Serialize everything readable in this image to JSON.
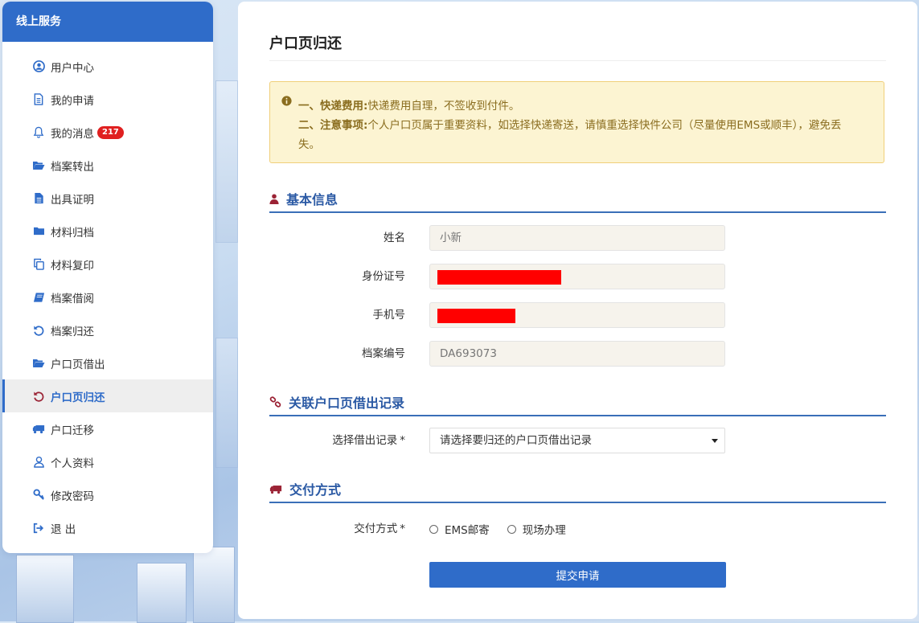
{
  "sidebar": {
    "title": "线上服务",
    "items": [
      {
        "label": "用户中心",
        "icon": "user-circle-icon"
      },
      {
        "label": "我的申请",
        "icon": "document-icon"
      },
      {
        "label": "我的消息",
        "icon": "bell-icon",
        "badge": "217"
      },
      {
        "label": "档案转出",
        "icon": "folder-open-icon"
      },
      {
        "label": "出具证明",
        "icon": "file-icon"
      },
      {
        "label": "材料归档",
        "icon": "folder-icon"
      },
      {
        "label": "材料复印",
        "icon": "copy-icon"
      },
      {
        "label": "档案借阅",
        "icon": "book-icon"
      },
      {
        "label": "档案归还",
        "icon": "undo-icon"
      },
      {
        "label": "户口页借出",
        "icon": "folder-open-icon"
      },
      {
        "label": "户口页归还",
        "icon": "undo-icon",
        "active": true
      },
      {
        "label": "户口迁移",
        "icon": "truck-icon"
      },
      {
        "label": "个人资料",
        "icon": "user-icon"
      },
      {
        "label": "修改密码",
        "icon": "key-icon"
      },
      {
        "label": "退 出",
        "icon": "logout-icon"
      }
    ]
  },
  "page": {
    "title": "户口页归还"
  },
  "notice": {
    "line1_prefix": "一、",
    "line1_bold": "快递费用:",
    "line1_text": "快递费用自理，不签收到付件。",
    "line2_prefix": "二、",
    "line2_bold": "注意事项:",
    "line2_text": "个人户口页属于重要资料，如选择快递寄送，请慎重选择快件公司（尽量使用EMS或顺丰），避免丢",
    "line3_text": "失。"
  },
  "basic_info": {
    "heading": "基本信息",
    "name_label": "姓名",
    "name_value": "小新",
    "id_label": "身份证号",
    "phone_label": "手机号",
    "archive_label": "档案编号",
    "archive_value": "DA693073"
  },
  "linked_record": {
    "heading": "关联户口页借出记录",
    "select_label": "选择借出记录",
    "required_mark": "*",
    "select_value": "请选择要归还的户口页借出记录"
  },
  "delivery": {
    "heading": "交付方式",
    "label": "交付方式",
    "required_mark": "*",
    "options": [
      "EMS邮寄",
      "现场办理"
    ]
  },
  "submit_label": "提交申请",
  "colors": {
    "primary": "#2f6cc9",
    "heading": "#2a59a4",
    "badge": "#e02020",
    "notice_bg": "#fcf4d2",
    "redaction": "#ff0000",
    "section_icon": "#9b2335"
  }
}
